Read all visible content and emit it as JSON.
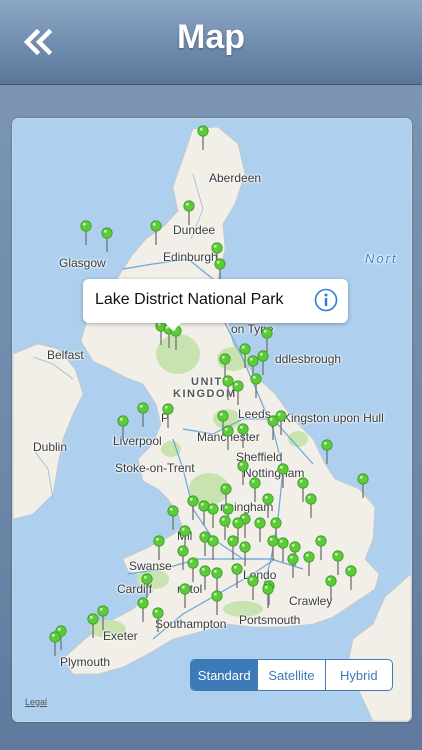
{
  "header": {
    "title": "Map",
    "back_icon": "double-chevron-left-icon"
  },
  "callout": {
    "title": "Lake District National Park",
    "info_icon": "info-icon"
  },
  "map_labels": {
    "aberdeen": "Aberdeen",
    "dundee": "Dundee",
    "glasgow": "Glasgow",
    "edinburgh": "Edinburgh",
    "north_sea": "Nort",
    "newcastle": "on Tyne",
    "belfast": "Belfast",
    "middlesbrough": "ddlesbrough",
    "united": "UNITE",
    "kingdom": "KINGDOM",
    "leeds": "Leeds",
    "hull": "Kingston upon Hull",
    "dublin": "Dublin",
    "liverpool": "Liverpool",
    "manchester": "Manchester",
    "sheffield": "Sheffield",
    "preston": "P",
    "stoke": "Stoke-on-Trent",
    "nottingham": "Nottingham",
    "birmingham": "rmingham",
    "milton": "Mil",
    "swansea": "Swanse",
    "cardiff": "Cardiff",
    "bristol": "ristol",
    "london": "Londo",
    "crawley": "Crawley",
    "exeter": "Exeter",
    "southampton": "Southampton",
    "portsmouth": "Portsmouth",
    "plymouth": "Plymouth"
  },
  "map_type": {
    "options": [
      "Standard",
      "Satellite",
      "Hybrid"
    ],
    "selected": "Standard"
  },
  "legal_label": "Legal",
  "colors": {
    "sea": "#aed0ee",
    "land": "#f1efe8",
    "park": "#c9e3b0",
    "pin": "#5ccb3a",
    "accent": "#3d7ab8",
    "header": "#6f8bad"
  }
}
